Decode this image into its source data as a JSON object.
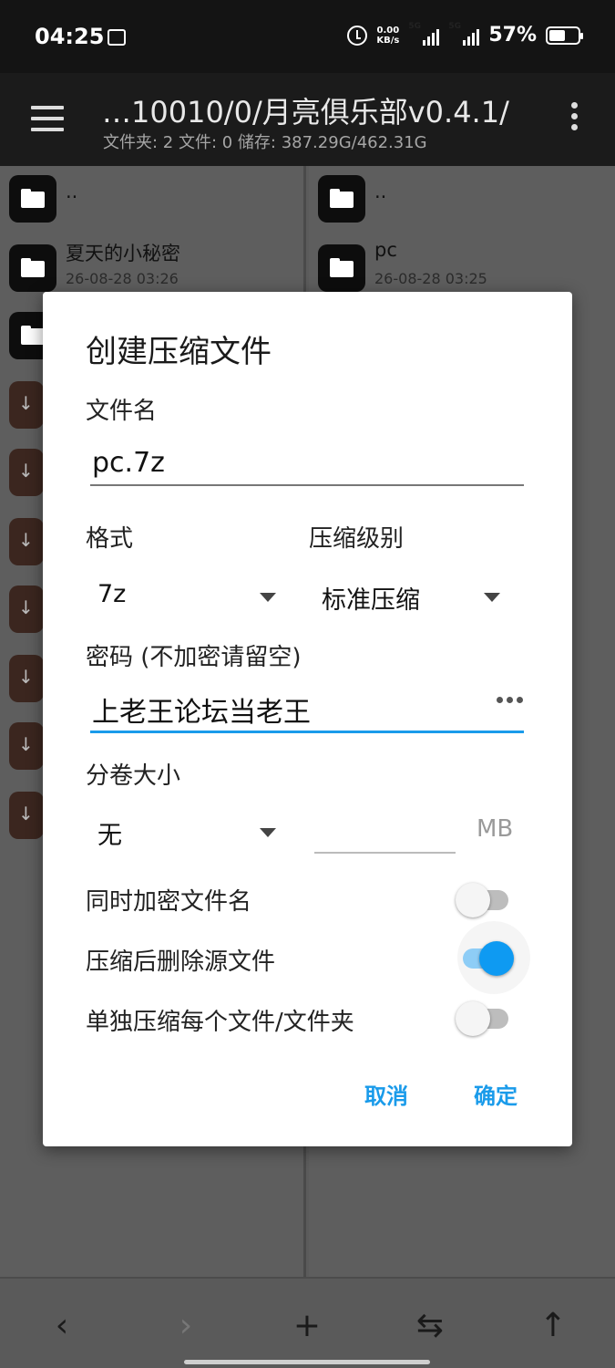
{
  "status_bar": {
    "time": "04:25",
    "net_speed_value": "0.00",
    "net_speed_unit": "KB/s",
    "sim1": "5G",
    "sim2": "5G",
    "battery": "57%"
  },
  "appbar": {
    "title": "…10010/0/月亮俱乐部v0.4.1/",
    "subtitle": "文件夹: 2  文件: 0  储存: 387.29G/462.31G"
  },
  "left_pane": {
    "items": [
      {
        "name": "..",
        "date": ""
      },
      {
        "name": "夏天的小秘密",
        "date": "26-08-28 03:26"
      }
    ]
  },
  "right_pane": {
    "items": [
      {
        "name": "..",
        "date": ""
      },
      {
        "name": "pc",
        "date": "26-08-28 03:25"
      }
    ]
  },
  "dialog": {
    "title": "创建压缩文件",
    "filename_label": "文件名",
    "filename_value": "pc.7z",
    "format_label": "格式",
    "format_value": "7z",
    "level_label": "压缩级别",
    "level_value": "标准压缩",
    "password_label": "密码 (不加密请留空)",
    "password_value": "上老王论坛当老王",
    "volume_label": "分卷大小",
    "volume_value": "无",
    "volume_unit": "MB",
    "encrypt_names_label": "同时加密文件名",
    "encrypt_names_on": false,
    "delete_source_label": "压缩后删除源文件",
    "delete_source_on": true,
    "separate_label": "单独压缩每个文件/文件夹",
    "separate_on": false,
    "cancel": "取消",
    "ok": "确定",
    "accent_color": "#1a9bea"
  },
  "bottom_bar": {
    "icons": [
      "back-icon",
      "forward-icon",
      "add-icon",
      "swap-icon",
      "up-icon"
    ]
  }
}
